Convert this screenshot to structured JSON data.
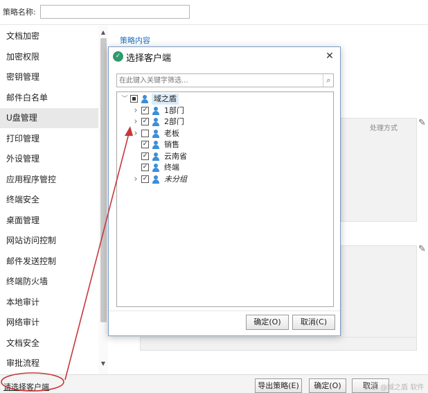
{
  "header": {
    "strategy_name_label": "策略名称:",
    "strategy_name_value": ""
  },
  "sidebar": {
    "items": [
      {
        "label": "文档加密"
      },
      {
        "label": "加密权限"
      },
      {
        "label": "密钥管理"
      },
      {
        "label": "邮件白名单"
      },
      {
        "label": "U盘管理",
        "active": true
      },
      {
        "label": "打印管理"
      },
      {
        "label": "外设管理"
      },
      {
        "label": "应用程序管控"
      },
      {
        "label": "终端安全"
      },
      {
        "label": "桌面管理"
      },
      {
        "label": "网站访问控制"
      },
      {
        "label": "邮件发送控制"
      },
      {
        "label": "终端防火墙"
      },
      {
        "label": "本地审计"
      },
      {
        "label": "网络审计"
      },
      {
        "label": "文档安全"
      },
      {
        "label": "审批流程"
      }
    ]
  },
  "background": {
    "section_title": "策略内容",
    "column_header": "处理方式"
  },
  "dialog": {
    "title": "选择客户端",
    "search_placeholder": "在此键入关键字筛选...",
    "tree": [
      {
        "label": "域之盾",
        "state": "partial",
        "expanded": true,
        "level": 0
      },
      {
        "label": "1部门",
        "state": "checked",
        "expandable": true,
        "level": 1
      },
      {
        "label": "2部门",
        "state": "checked",
        "expandable": true,
        "level": 1
      },
      {
        "label": "老板",
        "state": "unchecked",
        "expandable": true,
        "level": 1
      },
      {
        "label": "销售",
        "state": "checked",
        "expandable": false,
        "level": 1
      },
      {
        "label": "云南省",
        "state": "checked",
        "expandable": false,
        "level": 1
      },
      {
        "label": "终端",
        "state": "checked",
        "expandable": false,
        "level": 1
      },
      {
        "label": "未分组",
        "state": "checked",
        "expandable": true,
        "level": 1,
        "italic": true
      }
    ],
    "ok_label": "确定(O)",
    "cancel_label": "取消(C)"
  },
  "footer": {
    "select_client_link": "请选择客户端",
    "export_label": "导出策略(E)",
    "ok_label": "确定(O)",
    "cancel_label": "取消",
    "watermark": "头条 @域之盾 软件"
  },
  "colors": {
    "accent": "#1a6fbf",
    "annotation": "#c8363a",
    "user_icon": "#3a8fd8"
  }
}
